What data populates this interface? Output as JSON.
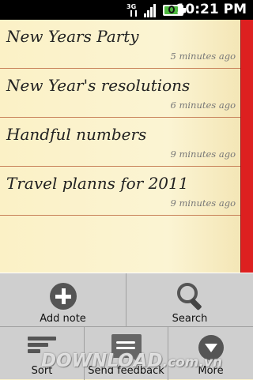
{
  "status_bar": {
    "network_label": "3G",
    "signal_bars": 4,
    "battery_fraction": 0.8,
    "time": "10:21 PM"
  },
  "notes": [
    {
      "title": "New Years Party",
      "time": "5 minutes ago"
    },
    {
      "title": "New Year's resolutions",
      "time": "6 minutes ago"
    },
    {
      "title": "Handful numbers",
      "time": "9 minutes ago"
    },
    {
      "title": "Travel planns for 2011",
      "time": "9 minutes ago"
    }
  ],
  "menu": {
    "add_note": "Add note",
    "search": "Search",
    "sort": "Sort",
    "send_feedback": "Send feedback",
    "more": "More"
  },
  "icons": {
    "add": "plus-circle-icon",
    "search": "magnifier-icon",
    "sort": "sort-lines-icon",
    "feedback": "speech-bubble-icon",
    "more": "chevron-down-circle-icon"
  },
  "colors": {
    "accent_strip": "#dd2020",
    "paper": "#fbf2c8",
    "separator": "#c8825a"
  },
  "watermark": {
    "main": "DOWNLOAD",
    "suffix": ".com.vn"
  }
}
